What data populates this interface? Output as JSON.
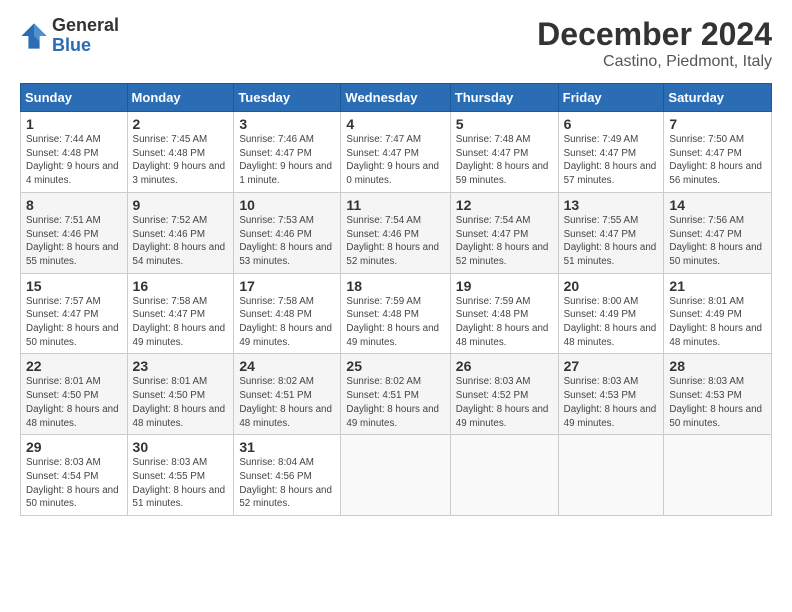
{
  "logo": {
    "general": "General",
    "blue": "Blue"
  },
  "title": "December 2024",
  "subtitle": "Castino, Piedmont, Italy",
  "days_of_week": [
    "Sunday",
    "Monday",
    "Tuesday",
    "Wednesday",
    "Thursday",
    "Friday",
    "Saturday"
  ],
  "weeks": [
    [
      {
        "day": "1",
        "sunrise": "7:44 AM",
        "sunset": "4:48 PM",
        "daylight": "9 hours and 4 minutes."
      },
      {
        "day": "2",
        "sunrise": "7:45 AM",
        "sunset": "4:48 PM",
        "daylight": "9 hours and 3 minutes."
      },
      {
        "day": "3",
        "sunrise": "7:46 AM",
        "sunset": "4:47 PM",
        "daylight": "9 hours and 1 minute."
      },
      {
        "day": "4",
        "sunrise": "7:47 AM",
        "sunset": "4:47 PM",
        "daylight": "9 hours and 0 minutes."
      },
      {
        "day": "5",
        "sunrise": "7:48 AM",
        "sunset": "4:47 PM",
        "daylight": "8 hours and 59 minutes."
      },
      {
        "day": "6",
        "sunrise": "7:49 AM",
        "sunset": "4:47 PM",
        "daylight": "8 hours and 57 minutes."
      },
      {
        "day": "7",
        "sunrise": "7:50 AM",
        "sunset": "4:47 PM",
        "daylight": "8 hours and 56 minutes."
      }
    ],
    [
      {
        "day": "8",
        "sunrise": "7:51 AM",
        "sunset": "4:46 PM",
        "daylight": "8 hours and 55 minutes."
      },
      {
        "day": "9",
        "sunrise": "7:52 AM",
        "sunset": "4:46 PM",
        "daylight": "8 hours and 54 minutes."
      },
      {
        "day": "10",
        "sunrise": "7:53 AM",
        "sunset": "4:46 PM",
        "daylight": "8 hours and 53 minutes."
      },
      {
        "day": "11",
        "sunrise": "7:54 AM",
        "sunset": "4:46 PM",
        "daylight": "8 hours and 52 minutes."
      },
      {
        "day": "12",
        "sunrise": "7:54 AM",
        "sunset": "4:47 PM",
        "daylight": "8 hours and 52 minutes."
      },
      {
        "day": "13",
        "sunrise": "7:55 AM",
        "sunset": "4:47 PM",
        "daylight": "8 hours and 51 minutes."
      },
      {
        "day": "14",
        "sunrise": "7:56 AM",
        "sunset": "4:47 PM",
        "daylight": "8 hours and 50 minutes."
      }
    ],
    [
      {
        "day": "15",
        "sunrise": "7:57 AM",
        "sunset": "4:47 PM",
        "daylight": "8 hours and 50 minutes."
      },
      {
        "day": "16",
        "sunrise": "7:58 AM",
        "sunset": "4:47 PM",
        "daylight": "8 hours and 49 minutes."
      },
      {
        "day": "17",
        "sunrise": "7:58 AM",
        "sunset": "4:48 PM",
        "daylight": "8 hours and 49 minutes."
      },
      {
        "day": "18",
        "sunrise": "7:59 AM",
        "sunset": "4:48 PM",
        "daylight": "8 hours and 49 minutes."
      },
      {
        "day": "19",
        "sunrise": "7:59 AM",
        "sunset": "4:48 PM",
        "daylight": "8 hours and 48 minutes."
      },
      {
        "day": "20",
        "sunrise": "8:00 AM",
        "sunset": "4:49 PM",
        "daylight": "8 hours and 48 minutes."
      },
      {
        "day": "21",
        "sunrise": "8:01 AM",
        "sunset": "4:49 PM",
        "daylight": "8 hours and 48 minutes."
      }
    ],
    [
      {
        "day": "22",
        "sunrise": "8:01 AM",
        "sunset": "4:50 PM",
        "daylight": "8 hours and 48 minutes."
      },
      {
        "day": "23",
        "sunrise": "8:01 AM",
        "sunset": "4:50 PM",
        "daylight": "8 hours and 48 minutes."
      },
      {
        "day": "24",
        "sunrise": "8:02 AM",
        "sunset": "4:51 PM",
        "daylight": "8 hours and 48 minutes."
      },
      {
        "day": "25",
        "sunrise": "8:02 AM",
        "sunset": "4:51 PM",
        "daylight": "8 hours and 49 minutes."
      },
      {
        "day": "26",
        "sunrise": "8:03 AM",
        "sunset": "4:52 PM",
        "daylight": "8 hours and 49 minutes."
      },
      {
        "day": "27",
        "sunrise": "8:03 AM",
        "sunset": "4:53 PM",
        "daylight": "8 hours and 49 minutes."
      },
      {
        "day": "28",
        "sunrise": "8:03 AM",
        "sunset": "4:53 PM",
        "daylight": "8 hours and 50 minutes."
      }
    ],
    [
      {
        "day": "29",
        "sunrise": "8:03 AM",
        "sunset": "4:54 PM",
        "daylight": "8 hours and 50 minutes."
      },
      {
        "day": "30",
        "sunrise": "8:03 AM",
        "sunset": "4:55 PM",
        "daylight": "8 hours and 51 minutes."
      },
      {
        "day": "31",
        "sunrise": "8:04 AM",
        "sunset": "4:56 PM",
        "daylight": "8 hours and 52 minutes."
      },
      null,
      null,
      null,
      null
    ]
  ]
}
